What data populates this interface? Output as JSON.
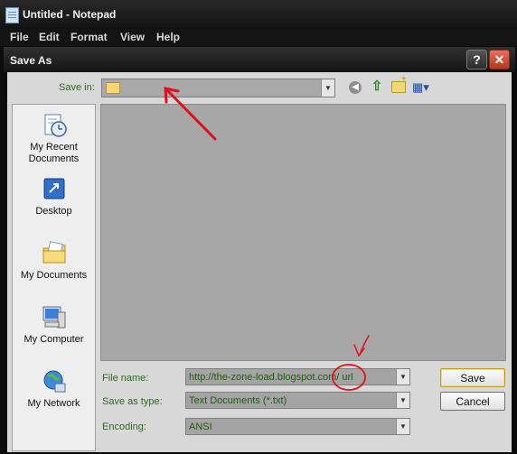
{
  "notepad": {
    "title": "Untitled - Notepad",
    "menu": [
      "File",
      "Edit",
      "Format",
      "View",
      "Help"
    ]
  },
  "dialog": {
    "title": "Save As",
    "help_label": "?",
    "close_label": "✕",
    "save_in": {
      "label": "Save in:",
      "value": ""
    },
    "places": [
      {
        "label": "My Recent Documents",
        "icon": "recent-documents-icon"
      },
      {
        "label": "Desktop",
        "icon": "desktop-icon"
      },
      {
        "label": "My Documents",
        "icon": "my-documents-icon"
      },
      {
        "label": "My Computer",
        "icon": "my-computer-icon"
      },
      {
        "label": "My Network",
        "icon": "my-network-icon"
      }
    ],
    "file_name": {
      "label": "File name:",
      "value": "http://the-zone-load.blogspot.com/ url"
    },
    "save_as_type": {
      "label": "Save as type:",
      "value": "Text Documents (*.txt)"
    },
    "encoding": {
      "label": "Encoding:",
      "value": "ANSI"
    },
    "buttons": {
      "save": "Save",
      "cancel": "Cancel"
    }
  },
  "colors": {
    "label_green": "#2e6a1b",
    "annotation_red": "#e0101a",
    "dialog_bg": "#d8d8d8"
  }
}
